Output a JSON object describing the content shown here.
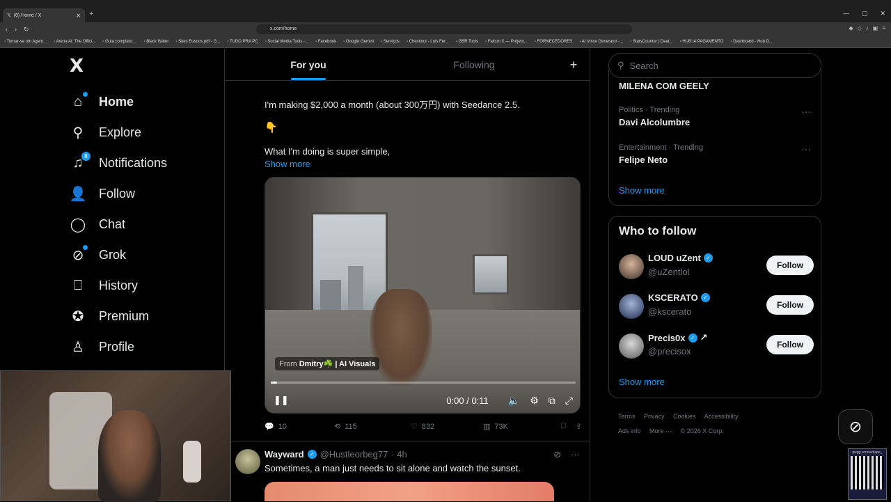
{
  "browser": {
    "tab_title": "(8) Home / X",
    "url": "x.com/home",
    "bookmarks": [
      "Tornar-se um Agent...",
      "Arena AI: The Offici...",
      "Guia completo:...",
      "Black Water",
      "Sites Eusoos.pdf - G...",
      "TUDO PRA PC",
      "Social Media Tools -...",
      "Facebook",
      "Google Gemini",
      "Serviços",
      "Checkout - Luis Fer...",
      "GBR Tools",
      "Falcon X — Projeto...",
      "FORNECEDORES",
      "AI Voice Generator -...",
      "StatsCounter | Deat...",
      "HUB IA PAGAMENTO",
      "Dashboard - Hub D..."
    ]
  },
  "sidebar": {
    "logo": "X",
    "items": [
      {
        "label": "Home",
        "icon": "home-icon"
      },
      {
        "label": "Explore",
        "icon": "search-icon"
      },
      {
        "label": "Notifications",
        "icon": "bell-icon",
        "badge": "8"
      },
      {
        "label": "Follow",
        "icon": "add-person-icon"
      },
      {
        "label": "Chat",
        "icon": "chat-icon"
      },
      {
        "label": "Grok",
        "icon": "grok-icon"
      },
      {
        "label": "History",
        "icon": "bookmark-icon"
      },
      {
        "label": "Premium",
        "icon": "verified-icon"
      },
      {
        "label": "Profile",
        "icon": "person-icon"
      }
    ]
  },
  "feed": {
    "tabs": [
      "For you",
      "Following"
    ],
    "post1": {
      "line1": "I'm making $2,000 a month (about 300万円) with Seedance 2.5.",
      "emoji": "👇",
      "line2": "What I'm doing is super simple,",
      "show_more": "Show more",
      "video": {
        "attribution_prefix": "From",
        "attribution_name": "Dmitry☘️ | AI Visuals",
        "time": "0:00 / 0:11",
        "progress": 0.02
      },
      "stats": {
        "replies": "10",
        "reposts": "115",
        "likes": "832",
        "views": "73K"
      }
    },
    "post2": {
      "name": "Wayward",
      "handle": "@Hustleorbeg77",
      "time": "· 4h",
      "text": "Sometimes, a man just needs to sit alone and watch the sunset."
    }
  },
  "right": {
    "search_placeholder": "Search",
    "trends": [
      {
        "meta": "",
        "title": "MILENA COM GEELY"
      },
      {
        "meta": "Politics · Trending",
        "title": "Davi Alcolumbre"
      },
      {
        "meta": "Entertainment · Trending",
        "title": "Felipe Neto"
      }
    ],
    "trends_show_more": "Show more",
    "who_to_follow": {
      "title": "Who to follow",
      "users": [
        {
          "name": "LOUD uZent",
          "handle": "@uZentlol",
          "button": "Follow"
        },
        {
          "name": "KSCERATO",
          "handle": "@kscerato",
          "button": "Follow"
        },
        {
          "name": "Precis0x",
          "handle": "@precisox",
          "button": "Follow"
        }
      ],
      "show_more": "Show more"
    },
    "footer": [
      "Terms",
      "Privacy",
      "Cookies",
      "Accessibility",
      "Ads info",
      "More ···",
      "© 2026 X Corp."
    ]
  },
  "overlay": {
    "qr_text": "pixgg.com/uzkape_"
  }
}
